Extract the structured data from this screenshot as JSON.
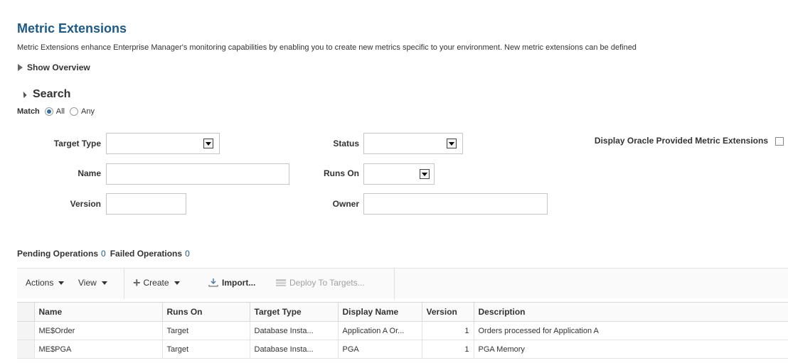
{
  "page": {
    "title": "Metric Extensions",
    "description": "Metric Extensions enhance Enterprise Manager's monitoring capabilities by enabling you to create new metrics specific to your environment. New metric extensions can be defined"
  },
  "overview": {
    "label": "Show Overview",
    "icon": "triangle-right-icon"
  },
  "search": {
    "title": "Search",
    "icon": "triangle-down-icon",
    "match_label": "Match",
    "match_all": "All",
    "match_any": "Any",
    "match_selected": "All",
    "fields": {
      "target_type": {
        "label": "Target Type",
        "value": ""
      },
      "status": {
        "label": "Status",
        "value": ""
      },
      "display_oracle": {
        "label": "Display Oracle Provided Metric Extensions",
        "checked": false
      },
      "name": {
        "label": "Name",
        "value": ""
      },
      "runs_on": {
        "label": "Runs On",
        "value": ""
      },
      "version": {
        "label": "Version",
        "value": ""
      },
      "owner": {
        "label": "Owner",
        "value": ""
      }
    }
  },
  "operations": {
    "pending_label": "Pending Operations",
    "pending_count": "0",
    "failed_label": "Failed Operations",
    "failed_count": "0"
  },
  "toolbar": {
    "actions": "Actions",
    "view": "View",
    "create": "Create",
    "import": "Import...",
    "deploy": "Deploy To Targets..."
  },
  "table": {
    "columns": [
      "Name",
      "Runs On",
      "Target Type",
      "Display Name",
      "Version",
      "Description"
    ],
    "rows": [
      {
        "name": "ME$Order",
        "runs_on": "Target",
        "target_type": "Database Insta...",
        "display_name": "Application A Or...",
        "version": "1",
        "description": "Orders processed for Application A"
      },
      {
        "name": "ME$PGA",
        "runs_on": "Target",
        "target_type": "Database Insta...",
        "display_name": "PGA",
        "version": "1",
        "description": "PGA Memory"
      }
    ]
  },
  "colors": {
    "title": "#1b5a8a",
    "link": "#1b5a8a",
    "radio_selected": "#2a6fb0"
  }
}
